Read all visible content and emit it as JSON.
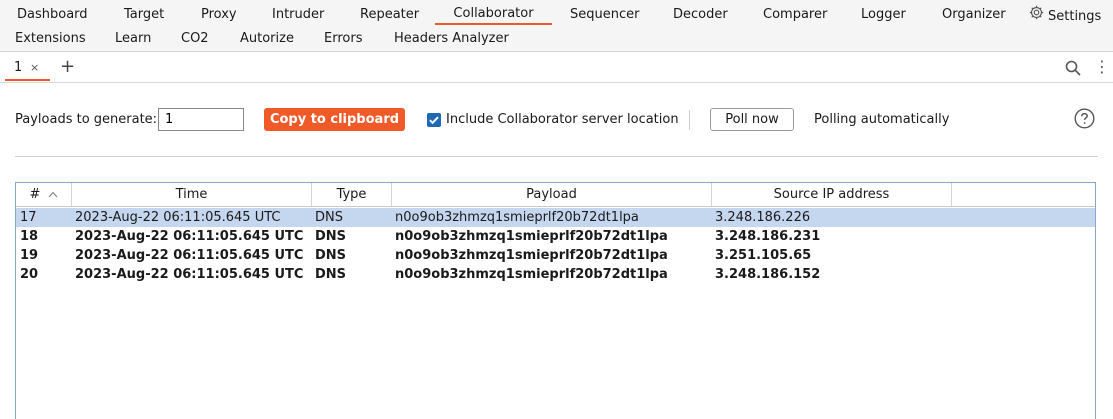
{
  "top_tabs": [
    {
      "label": "Dashboard"
    },
    {
      "label": "Target"
    },
    {
      "label": "Proxy"
    },
    {
      "label": "Intruder"
    },
    {
      "label": "Repeater"
    },
    {
      "label": "Collaborator",
      "active": true
    },
    {
      "label": "Sequencer"
    },
    {
      "label": "Decoder"
    },
    {
      "label": "Comparer"
    },
    {
      "label": "Logger"
    },
    {
      "label": "Organizer"
    },
    {
      "label": "Settings",
      "icon": "gear-icon"
    },
    {
      "label": "Extensions"
    },
    {
      "label": "Learn"
    },
    {
      "label": "CO2"
    },
    {
      "label": "Autorize"
    },
    {
      "label": "Errors"
    },
    {
      "label": "Headers Analyzer"
    }
  ],
  "sub_tabs": {
    "tab_label": "1",
    "close_glyph": "×",
    "add_glyph": "+",
    "more_glyph": "⋮"
  },
  "controls": {
    "payloads_label": "Payloads to generate:",
    "payloads_value": "1",
    "copy_button": "Copy to clipboard",
    "include_checkbox_label": "Include Collaborator server location",
    "include_checked": true,
    "poll_button": "Poll now",
    "polling_status": "Polling automatically"
  },
  "table": {
    "columns": [
      {
        "label": "#",
        "sort": "ascending"
      },
      {
        "label": "Time"
      },
      {
        "label": "Type"
      },
      {
        "label": "Payload"
      },
      {
        "label": "Source IP address"
      },
      {
        "label": ""
      }
    ],
    "rows": [
      {
        "num": "17",
        "time": "2023-Aug-22 06:11:05.645 UTC",
        "type": "DNS",
        "payload": "n0o9ob3zhmzq1smieprlf20b72dt1lpa",
        "ip": "3.248.186.226",
        "selected": true,
        "unread": false
      },
      {
        "num": "18",
        "time": "2023-Aug-22 06:11:05.645 UTC",
        "type": "DNS",
        "payload": "n0o9ob3zhmzq1smieprlf20b72dt1lpa",
        "ip": "3.248.186.231",
        "selected": false,
        "unread": true
      },
      {
        "num": "19",
        "time": "2023-Aug-22 06:11:05.645 UTC",
        "type": "DNS",
        "payload": "n0o9ob3zhmzq1smieprlf20b72dt1lpa",
        "ip": "3.251.105.65",
        "selected": false,
        "unread": true
      },
      {
        "num": "20",
        "time": "2023-Aug-22 06:11:05.645 UTC",
        "type": "DNS",
        "payload": "n0o9ob3zhmzq1smieprlf20b72dt1lpa",
        "ip": "3.248.186.152",
        "selected": false,
        "unread": true
      }
    ]
  },
  "colors": {
    "accent": "#f05a28",
    "selected_row": "#c5d7ef",
    "checkbox": "#1f68b3"
  }
}
